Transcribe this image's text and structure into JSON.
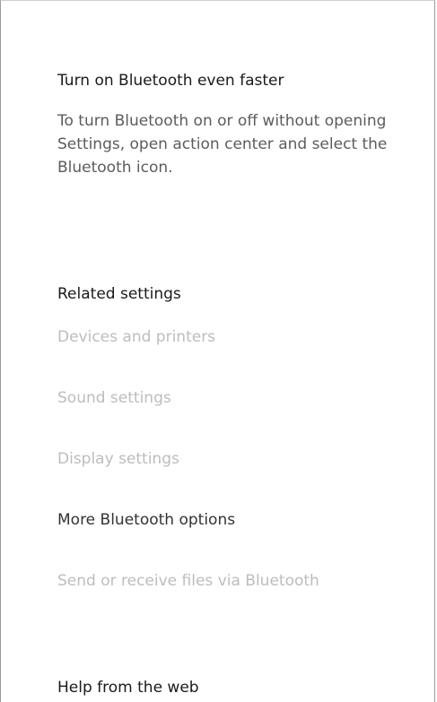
{
  "tip": {
    "title": "Turn on Bluetooth even faster",
    "description": "To turn Bluetooth on or off without opening Settings, open action center and select the Bluetooth icon."
  },
  "related_settings": {
    "title": "Related settings",
    "items": [
      {
        "label": "Devices and printers",
        "enabled": false
      },
      {
        "label": "Sound settings",
        "enabled": false
      },
      {
        "label": "Display settings",
        "enabled": false
      },
      {
        "label": "More Bluetooth options",
        "enabled": true
      },
      {
        "label": "Send or receive files via Bluetooth",
        "enabled": false
      }
    ]
  },
  "help": {
    "title": "Help from the web"
  }
}
